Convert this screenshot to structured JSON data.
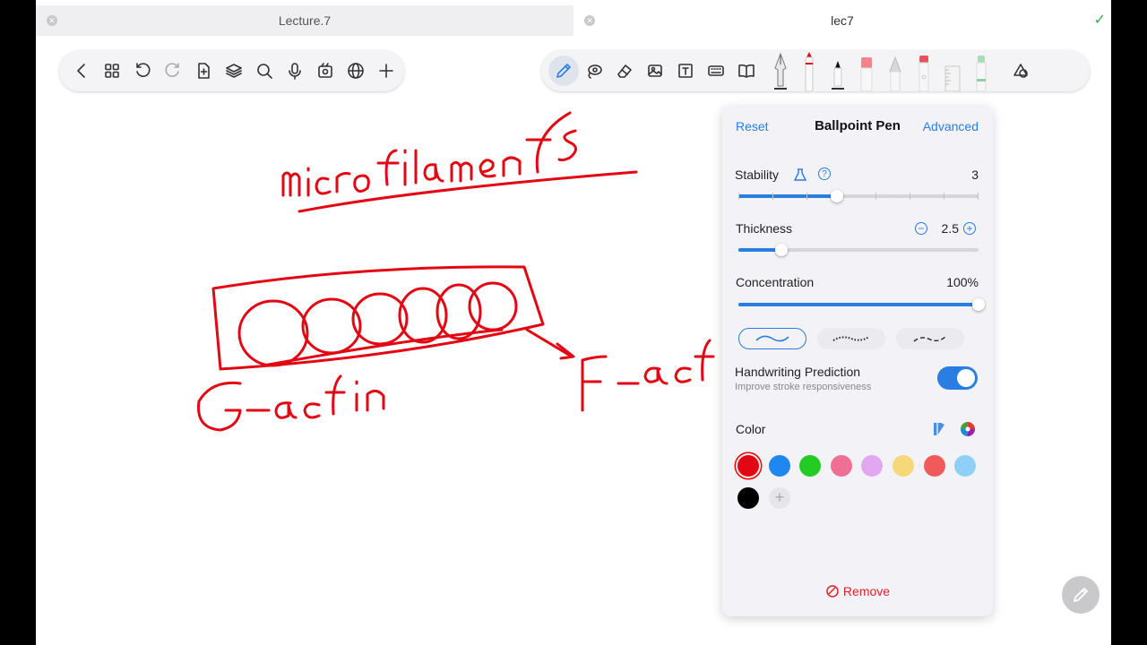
{
  "tabs": [
    {
      "label": "Lecture.7",
      "active": false
    },
    {
      "label": "lec7",
      "active": true
    }
  ],
  "toolbar_left": {
    "items": [
      "back-icon",
      "grid-icon",
      "undo-icon",
      "redo-icon",
      "add-page-icon",
      "layers-icon",
      "search-icon",
      "microphone-icon",
      "media-icon",
      "globe-icon",
      "plus-icon"
    ]
  },
  "toolbar_right": {
    "items": [
      "pen-tool-icon",
      "lasso-tool-icon",
      "eraser-tool-icon",
      "image-tool-icon",
      "text-tool-icon",
      "keyboard-icon",
      "book-icon"
    ],
    "pens": [
      "fountain-pen",
      "ballpoint-pen-red",
      "marker-black",
      "highlighter-pink",
      "brush",
      "pencil-red",
      "ruler",
      "highlighter-green"
    ],
    "extra": "shapes-icon"
  },
  "canvas": {
    "text_word1": "microfilaments",
    "text_word2": "G-actin",
    "text_word3": "F-acti"
  },
  "panel": {
    "reset": "Reset",
    "title": "Ballpoint Pen",
    "advanced": "Advanced",
    "stability": {
      "label": "Stability",
      "value": "3",
      "fraction": 0.41
    },
    "thickness": {
      "label": "Thickness",
      "value": "2.5",
      "fraction": 0.18
    },
    "concentration": {
      "label": "Concentration",
      "value": "100%",
      "fraction": 1.0
    },
    "stroke_styles": [
      "smooth",
      "dotted",
      "dashed"
    ],
    "handwriting": {
      "label": "Handwriting Prediction",
      "sub": "Improve stroke responsiveness",
      "on": true
    },
    "color": {
      "label": "Color"
    },
    "swatches": [
      "#e30613",
      "#1e88f0",
      "#22cc22",
      "#ef6f97",
      "#e3a6f0",
      "#f6d879",
      "#f05a5a",
      "#8fd0f8",
      "#000000"
    ],
    "selected_swatch": "#e30613",
    "remove": "Remove"
  },
  "ink_color": "#e30613"
}
